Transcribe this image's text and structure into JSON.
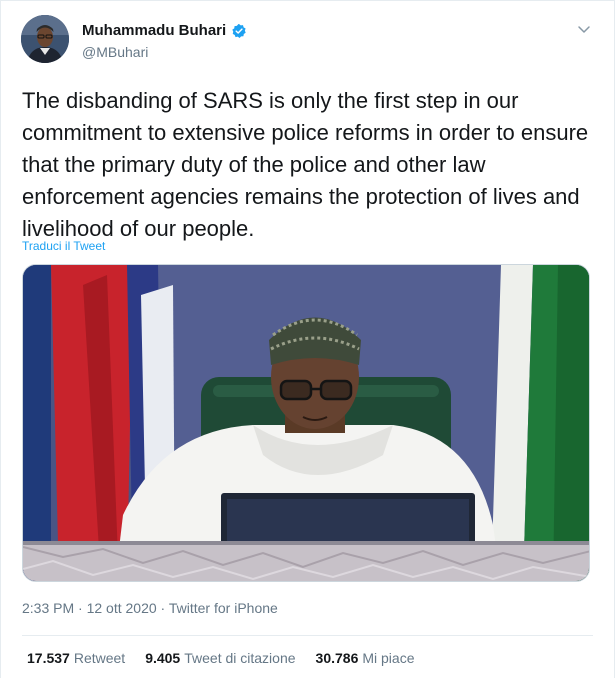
{
  "author": {
    "name": "Muhammadu Buhari",
    "handle": "@MBuhari",
    "verified": true
  },
  "tweet": {
    "text": "The disbanding of SARS is only the first step in our commitment to extensive police reforms in order to ensure that the primary duty of the police and other law enforcement agencies remains the protection of lives and livelihood of our people.",
    "translate_link": "Traduci il Tweet",
    "time": "2:33 PM",
    "date": "12 ott 2020",
    "separator": "·",
    "source": "Twitter for iPhone"
  },
  "stats": [
    {
      "value": "17.537",
      "label": "Retweet"
    },
    {
      "value": "9.405",
      "label": "Tweet di citazione"
    },
    {
      "value": "30.786",
      "label": "Mi piace"
    }
  ],
  "colors": {
    "accent": "#1da1f2",
    "text": "#14171a",
    "muted": "#657786",
    "border": "#e6ecf0"
  },
  "icons": [
    "verified-badge-icon",
    "chevron-down-icon"
  ]
}
